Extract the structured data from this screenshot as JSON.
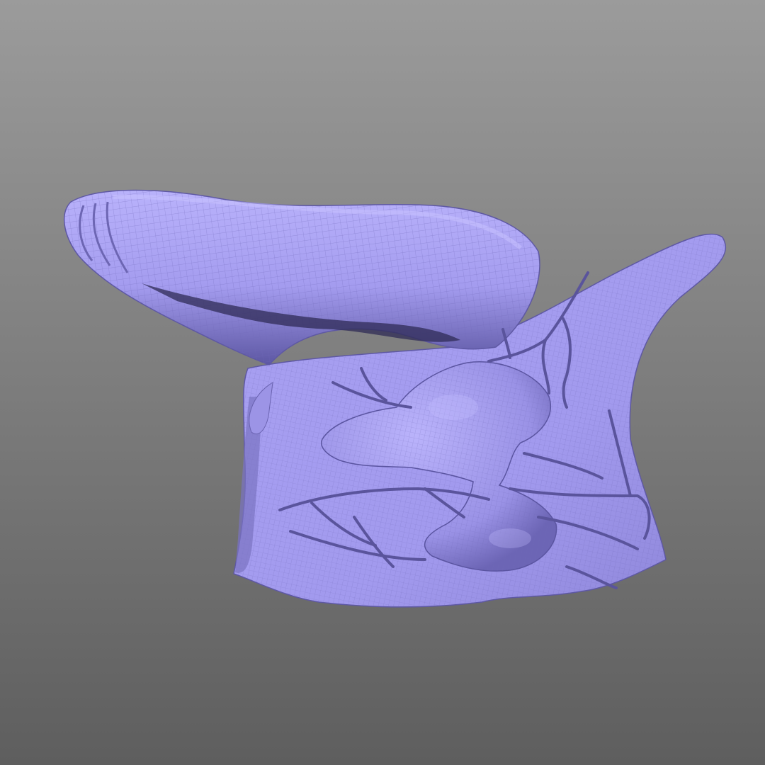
{
  "viewport": {
    "background_top": "#9b9b9b",
    "background_bottom": "#5e5e5e"
  },
  "model": {
    "kind": "sculpted-3d-mesh",
    "description_icon": "wireframe-mesh-icon",
    "base_color": "#a79ff0",
    "shadow_color": "#6d66b3",
    "wire_color": "#7c75c4",
    "display_mode": "shaded-with-wireframe"
  }
}
